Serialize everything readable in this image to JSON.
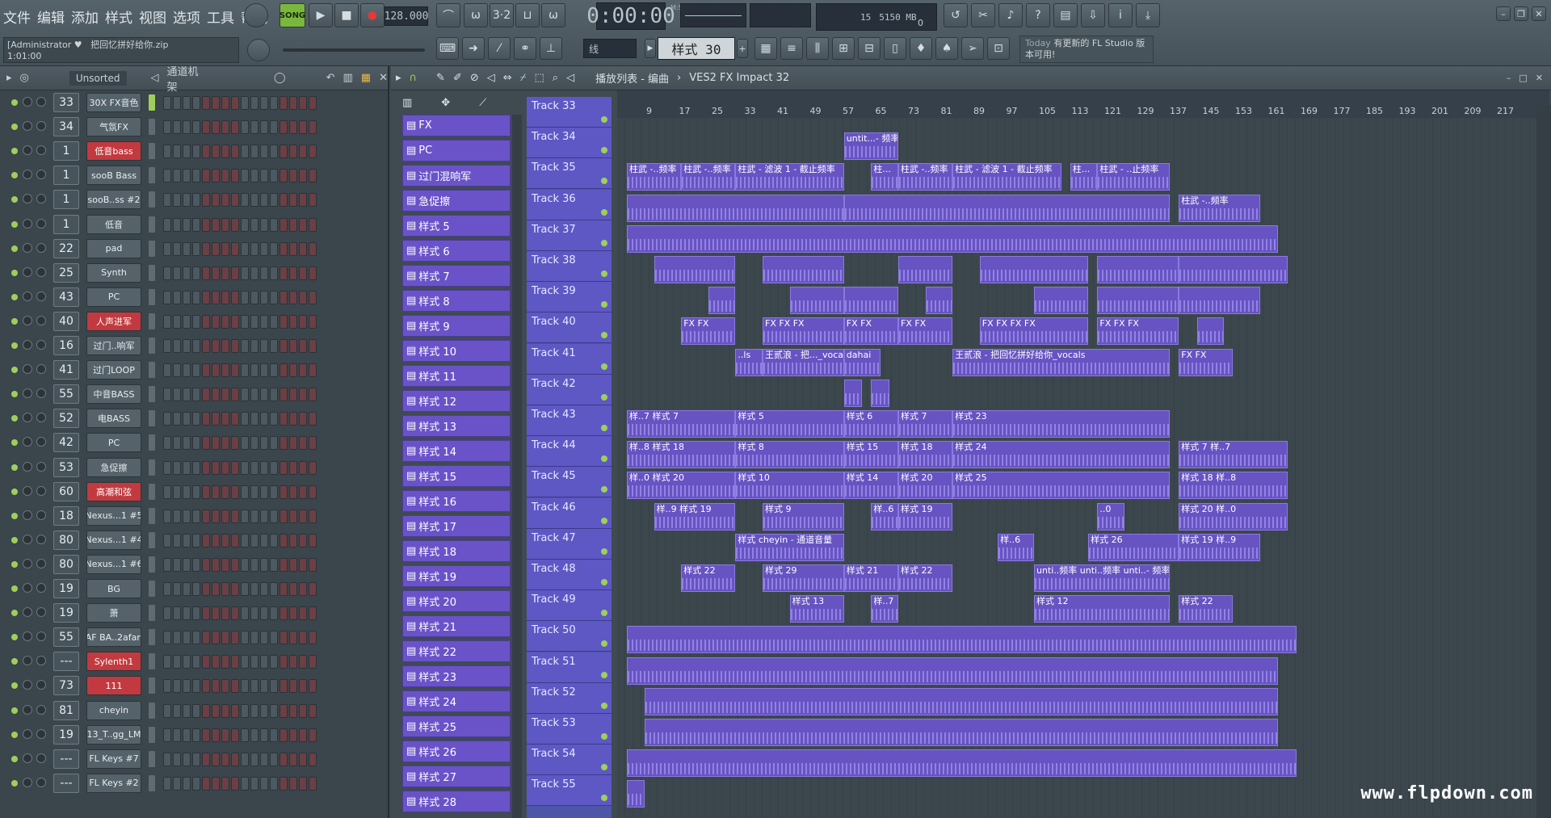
{
  "menu": [
    "文件",
    "编辑",
    "添加",
    "样式",
    "视图",
    "选项",
    "工具",
    "帮助"
  ],
  "transport": {
    "mode": "SONG",
    "tempo": "128.000",
    "time": "0:00:00",
    "time_unit": "M:S:CS",
    "cpu": "15",
    "ram": "5150 MB",
    "voices": "0"
  },
  "song": {
    "user": "[Administrator ♥",
    "file": "把回忆拼好给你.zip",
    "position": "1:01:00"
  },
  "toolbar2": {
    "snap": "线",
    "pattern": "样式 30",
    "news_today": "Today",
    "news_text": "有更新的 FL Studio 版本可用!"
  },
  "rack": {
    "filter": "Unsorted",
    "title": "通道机架"
  },
  "channels": [
    {
      "num": "33",
      "name": "30X FX音色",
      "red": false
    },
    {
      "num": "34",
      "name": "气氛FX",
      "red": false
    },
    {
      "num": "1",
      "name": "低音bass",
      "red": true
    },
    {
      "num": "1",
      "name": "sooB Bass",
      "red": false
    },
    {
      "num": "1",
      "name": "sooB..ss #2",
      "red": false
    },
    {
      "num": "1",
      "name": "低音",
      "red": false
    },
    {
      "num": "22",
      "name": "pad",
      "red": false
    },
    {
      "num": "25",
      "name": "Synth",
      "red": false
    },
    {
      "num": "43",
      "name": "PC",
      "red": false
    },
    {
      "num": "40",
      "name": "人声进军",
      "red": true
    },
    {
      "num": "16",
      "name": "过门..响军",
      "red": false
    },
    {
      "num": "41",
      "name": "过门LOOP",
      "red": false
    },
    {
      "num": "55",
      "name": "中音BASS",
      "red": false
    },
    {
      "num": "52",
      "name": "电BASS",
      "red": false
    },
    {
      "num": "42",
      "name": "PC",
      "red": false
    },
    {
      "num": "53",
      "name": "急促擦",
      "red": false
    },
    {
      "num": "60",
      "name": "高潮和弦",
      "red": true
    },
    {
      "num": "18",
      "name": "Nexus...1 #5",
      "red": false
    },
    {
      "num": "80",
      "name": "Nexus...1 #4",
      "red": false
    },
    {
      "num": "80",
      "name": "Nexus...1 #6",
      "red": false
    },
    {
      "num": "19",
      "name": "BG",
      "red": false
    },
    {
      "num": "19",
      "name": "萧",
      "red": false
    },
    {
      "num": "55",
      "name": "AF BA..2afan",
      "red": false
    },
    {
      "num": "---",
      "name": "Sylenth1",
      "red": true
    },
    {
      "num": "73",
      "name": "111",
      "red": true
    },
    {
      "num": "81",
      "name": "cheyin",
      "red": false
    },
    {
      "num": "19",
      "name": "13_T..gg_LM",
      "red": false
    },
    {
      "num": "---",
      "name": "FL Keys #7",
      "red": false
    },
    {
      "num": "---",
      "name": "FL Keys #2",
      "red": false
    }
  ],
  "playlist": {
    "title": "播放列表 - 编曲",
    "breadcrumb": "VES2 FX Impact 32"
  },
  "patterns": [
    "FX",
    "PC",
    "过门混响军",
    "急促擦",
    "样式 5",
    "样式 6",
    "样式 7",
    "样式 8",
    "样式 9",
    "样式 10",
    "样式 11",
    "样式 12",
    "样式 13",
    "样式 14",
    "样式 15",
    "样式 16",
    "样式 17",
    "样式 18",
    "样式 19",
    "样式 20",
    "样式 21",
    "样式 22",
    "样式 23",
    "样式 24",
    "样式 25",
    "样式 26",
    "样式 27",
    "样式 28"
  ],
  "tracks": [
    "Track 33",
    "Track 34",
    "Track 35",
    "Track 36",
    "Track 37",
    "Track 38",
    "Track 39",
    "Track 40",
    "Track 41",
    "Track 42",
    "Track 43",
    "Track 44",
    "Track 45",
    "Track 46",
    "Track 47",
    "Track 48",
    "Track 49",
    "Track 50",
    "Track 51",
    "Track 52",
    "Track 53",
    "Track 54",
    "Track 55"
  ],
  "ruler": [
    "9",
    "17",
    "25",
    "33",
    "41",
    "49",
    "57",
    "65",
    "73",
    "81",
    "89",
    "97",
    "105",
    "113",
    "121",
    "129",
    "137",
    "145",
    "153",
    "161",
    "169",
    "177",
    "185",
    "193",
    "201",
    "209",
    "217"
  ],
  "clips": [
    {
      "track": 1,
      "start": 0.24,
      "len": 0.06,
      "label": "untit...- 频率"
    },
    {
      "track": 2,
      "start": 0.0,
      "len": 0.06,
      "label": "柱武 -..频率"
    },
    {
      "track": 2,
      "start": 0.06,
      "len": 0.06,
      "label": "柱武 -..频率"
    },
    {
      "track": 2,
      "start": 0.12,
      "len": 0.12,
      "label": "柱武 - 滤波 1 - 截止频率"
    },
    {
      "track": 2,
      "start": 0.27,
      "len": 0.03,
      "label": "柱..."
    },
    {
      "track": 2,
      "start": 0.3,
      "len": 0.06,
      "label": "柱武 -..频率"
    },
    {
      "track": 2,
      "start": 0.36,
      "len": 0.12,
      "label": "柱武 - 滤波 1 - 截止频率"
    },
    {
      "track": 2,
      "start": 0.49,
      "len": 0.03,
      "label": "柱..."
    },
    {
      "track": 2,
      "start": 0.52,
      "len": 0.08,
      "label": "柱武 - ..止频率"
    },
    {
      "track": 3,
      "start": 0.0,
      "len": 0.24,
      "label": ""
    },
    {
      "track": 3,
      "start": 0.24,
      "len": 0.36,
      "label": ""
    },
    {
      "track": 3,
      "start": 0.61,
      "len": 0.09,
      "label": "柱武 -..频率"
    },
    {
      "track": 4,
      "start": 0.0,
      "len": 0.72,
      "label": ""
    },
    {
      "track": 5,
      "start": 0.03,
      "len": 0.09,
      "label": ""
    },
    {
      "track": 5,
      "start": 0.15,
      "len": 0.09,
      "label": ""
    },
    {
      "track": 5,
      "start": 0.3,
      "len": 0.06,
      "label": ""
    },
    {
      "track": 5,
      "start": 0.39,
      "len": 0.12,
      "label": ""
    },
    {
      "track": 5,
      "start": 0.52,
      "len": 0.09,
      "label": ""
    },
    {
      "track": 5,
      "start": 0.61,
      "len": 0.12,
      "label": ""
    },
    {
      "track": 6,
      "start": 0.09,
      "len": 0.03,
      "label": ""
    },
    {
      "track": 6,
      "start": 0.18,
      "len": 0.06,
      "label": ""
    },
    {
      "track": 6,
      "start": 0.24,
      "len": 0.06,
      "label": ""
    },
    {
      "track": 6,
      "start": 0.33,
      "len": 0.03,
      "label": ""
    },
    {
      "track": 6,
      "start": 0.45,
      "len": 0.06,
      "label": ""
    },
    {
      "track": 6,
      "start": 0.52,
      "len": 0.09,
      "label": ""
    },
    {
      "track": 6,
      "start": 0.61,
      "len": 0.09,
      "label": ""
    },
    {
      "track": 7,
      "start": 0.06,
      "len": 0.06,
      "label": "FX  FX"
    },
    {
      "track": 7,
      "start": 0.15,
      "len": 0.09,
      "label": "FX  FX  FX"
    },
    {
      "track": 7,
      "start": 0.24,
      "len": 0.06,
      "label": "FX  FX"
    },
    {
      "track": 7,
      "start": 0.3,
      "len": 0.06,
      "label": "FX  FX"
    },
    {
      "track": 7,
      "start": 0.39,
      "len": 0.12,
      "label": "FX  FX  FX  FX"
    },
    {
      "track": 7,
      "start": 0.52,
      "len": 0.09,
      "label": "FX  FX  FX"
    },
    {
      "track": 7,
      "start": 0.63,
      "len": 0.03,
      "label": ""
    },
    {
      "track": 8,
      "start": 0.12,
      "len": 0.03,
      "label": "..ls"
    },
    {
      "track": 8,
      "start": 0.15,
      "len": 0.09,
      "label": "王贰浪 - 把..._vocals"
    },
    {
      "track": 8,
      "start": 0.24,
      "len": 0.04,
      "label": "dahai"
    },
    {
      "track": 8,
      "start": 0.36,
      "len": 0.24,
      "label": "王贰浪 - 把回忆拼好给你_vocals"
    },
    {
      "track": 8,
      "start": 0.61,
      "len": 0.06,
      "label": "FX  FX"
    },
    {
      "track": 9,
      "start": 0.24,
      "len": 0.02,
      "label": ""
    },
    {
      "track": 9,
      "start": 0.27,
      "len": 0.02,
      "label": ""
    },
    {
      "track": 10,
      "start": 0.0,
      "len": 0.12,
      "label": "样..7  样式 7"
    },
    {
      "track": 10,
      "start": 0.12,
      "len": 0.12,
      "label": "样式 5"
    },
    {
      "track": 10,
      "start": 0.24,
      "len": 0.06,
      "label": "样式 6"
    },
    {
      "track": 10,
      "start": 0.3,
      "len": 0.06,
      "label": "样式 7"
    },
    {
      "track": 10,
      "start": 0.36,
      "len": 0.24,
      "label": "样式 23"
    },
    {
      "track": 11,
      "start": 0.0,
      "len": 0.12,
      "label": "样..8  样式 18"
    },
    {
      "track": 11,
      "start": 0.12,
      "len": 0.12,
      "label": "样式 8"
    },
    {
      "track": 11,
      "start": 0.24,
      "len": 0.06,
      "label": "样式 15"
    },
    {
      "track": 11,
      "start": 0.3,
      "len": 0.06,
      "label": "样式 18"
    },
    {
      "track": 11,
      "start": 0.36,
      "len": 0.24,
      "label": "样式 24"
    },
    {
      "track": 11,
      "start": 0.61,
      "len": 0.12,
      "label": "样式 7  样..7"
    },
    {
      "track": 12,
      "start": 0.0,
      "len": 0.12,
      "label": "样..0  样式 20"
    },
    {
      "track": 12,
      "start": 0.12,
      "len": 0.12,
      "label": "样式 10"
    },
    {
      "track": 12,
      "start": 0.24,
      "len": 0.06,
      "label": "样式 14"
    },
    {
      "track": 12,
      "start": 0.3,
      "len": 0.06,
      "label": "样式 20"
    },
    {
      "track": 12,
      "start": 0.36,
      "len": 0.24,
      "label": "样式 25"
    },
    {
      "track": 12,
      "start": 0.61,
      "len": 0.12,
      "label": "样式 18  样..8"
    },
    {
      "track": 13,
      "start": 0.03,
      "len": 0.09,
      "label": "样..9  样式 19"
    },
    {
      "track": 13,
      "start": 0.15,
      "len": 0.09,
      "label": "样式 9"
    },
    {
      "track": 13,
      "start": 0.27,
      "len": 0.03,
      "label": "样..6"
    },
    {
      "track": 13,
      "start": 0.3,
      "len": 0.06,
      "label": "样式 19"
    },
    {
      "track": 13,
      "start": 0.52,
      "len": 0.03,
      "label": "..0"
    },
    {
      "track": 13,
      "start": 0.61,
      "len": 0.12,
      "label": "样式 20  样..0"
    },
    {
      "track": 14,
      "start": 0.12,
      "len": 0.12,
      "label": "样式  cheyin - 通道音量"
    },
    {
      "track": 14,
      "start": 0.41,
      "len": 0.04,
      "label": "样..6"
    },
    {
      "track": 14,
      "start": 0.51,
      "len": 0.1,
      "label": "样式 26"
    },
    {
      "track": 14,
      "start": 0.61,
      "len": 0.09,
      "label": "样式 19  样..9"
    },
    {
      "track": 15,
      "start": 0.06,
      "len": 0.06,
      "label": "样式 22"
    },
    {
      "track": 15,
      "start": 0.15,
      "len": 0.09,
      "label": "样式 29"
    },
    {
      "track": 15,
      "start": 0.24,
      "len": 0.06,
      "label": "样式 21"
    },
    {
      "track": 15,
      "start": 0.3,
      "len": 0.06,
      "label": "样式 22"
    },
    {
      "track": 15,
      "start": 0.45,
      "len": 0.15,
      "label": "unti..频率  unti..频率  unti..- 频率"
    },
    {
      "track": 16,
      "start": 0.18,
      "len": 0.06,
      "label": "样式 13"
    },
    {
      "track": 16,
      "start": 0.27,
      "len": 0.03,
      "label": "样..7"
    },
    {
      "track": 16,
      "start": 0.45,
      "len": 0.15,
      "label": "样式 12"
    },
    {
      "track": 16,
      "start": 0.61,
      "len": 0.06,
      "label": "样式 22"
    },
    {
      "track": 17,
      "start": 0.0,
      "len": 0.74,
      "label": ""
    },
    {
      "track": 18,
      "start": 0.0,
      "len": 0.72,
      "label": ""
    },
    {
      "track": 19,
      "start": 0.02,
      "len": 0.7,
      "label": ""
    },
    {
      "track": 20,
      "start": 0.02,
      "len": 0.7,
      "label": ""
    },
    {
      "track": 21,
      "start": 0.0,
      "len": 0.74,
      "label": ""
    },
    {
      "track": 22,
      "start": 0.0,
      "len": 0.02,
      "label": ""
    }
  ],
  "watermark": "www.flpdown.com"
}
